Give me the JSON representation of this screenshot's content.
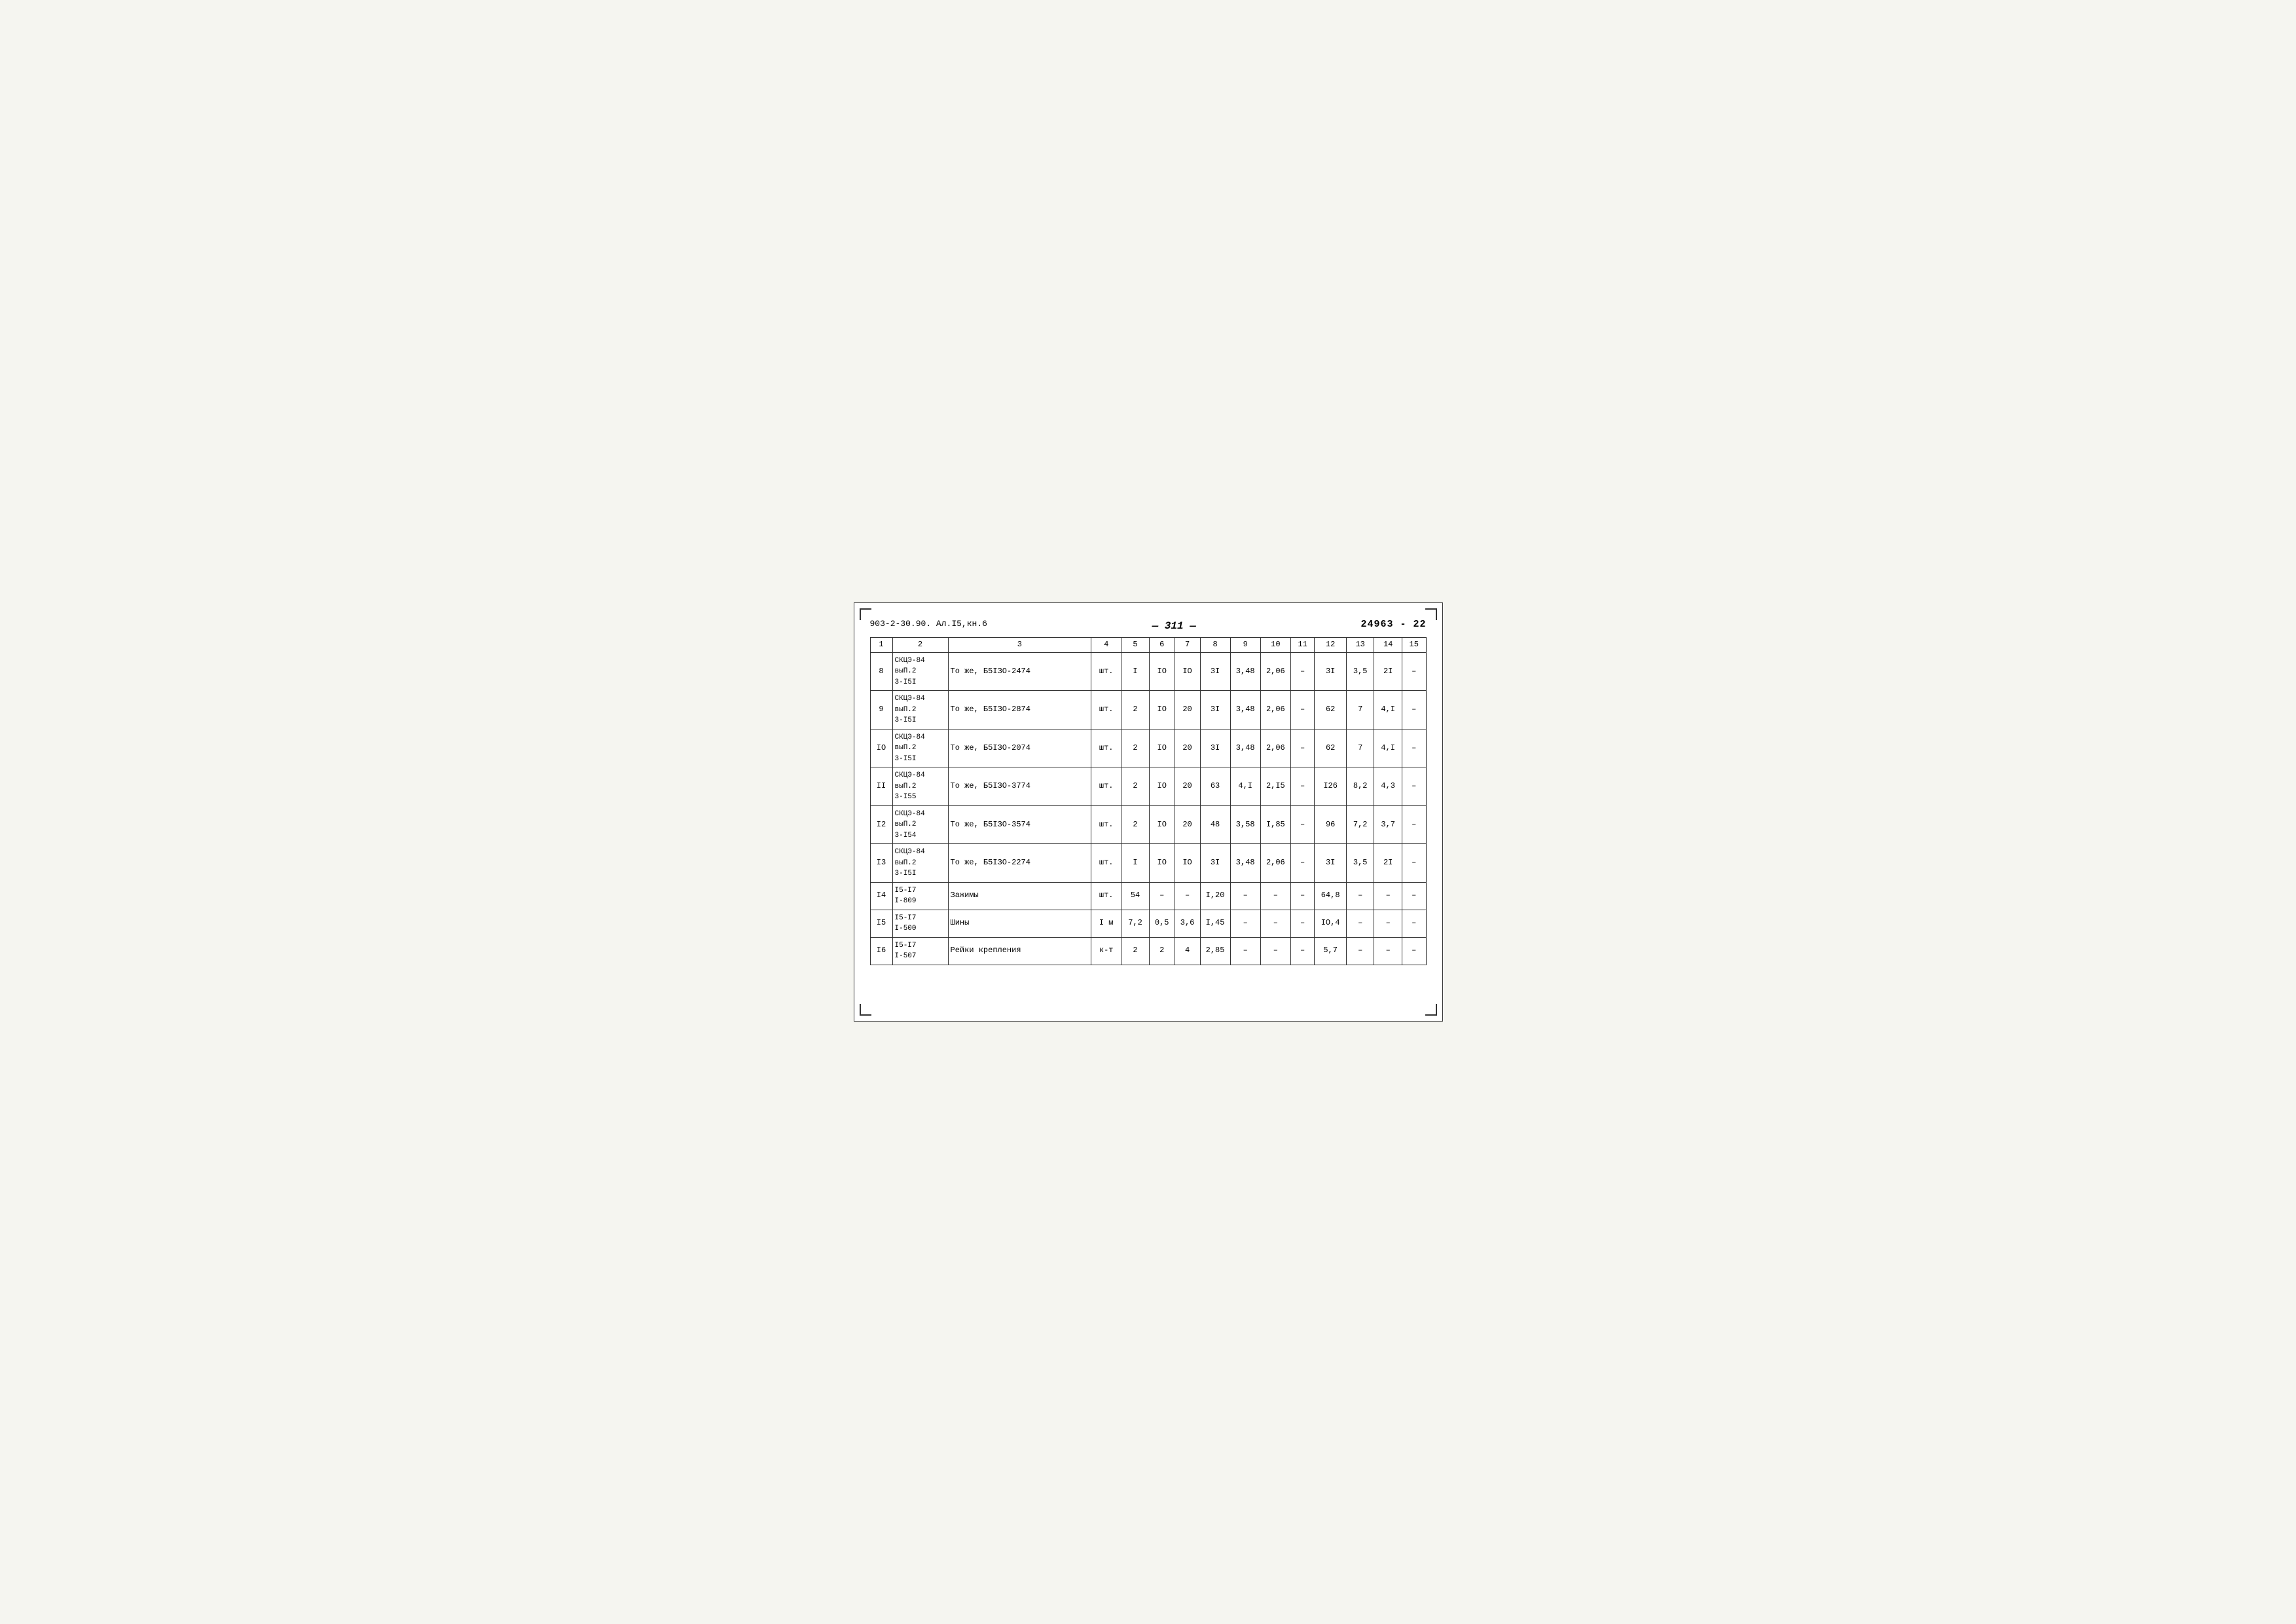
{
  "header": {
    "doc_ref": "903-2-30.90. Ал.I5,кн.6",
    "page_num": "— 311 —",
    "doc_num": "24963 - 22"
  },
  "table": {
    "columns": [
      {
        "id": "1",
        "label": "1"
      },
      {
        "id": "2",
        "label": "2"
      },
      {
        "id": "3",
        "label": "3"
      },
      {
        "id": "4",
        "label": "4"
      },
      {
        "id": "5",
        "label": "5"
      },
      {
        "id": "6",
        "label": "6"
      },
      {
        "id": "7",
        "label": "7"
      },
      {
        "id": "8",
        "label": "8"
      },
      {
        "id": "9",
        "label": "9"
      },
      {
        "id": "10",
        "label": "10"
      },
      {
        "id": "11",
        "label": "11"
      },
      {
        "id": "12",
        "label": "12"
      },
      {
        "id": "13",
        "label": "13"
      },
      {
        "id": "14",
        "label": "14"
      },
      {
        "id": "15",
        "label": "15"
      }
    ],
    "rows": [
      {
        "c1": "8",
        "c2_line1": "СКЦЭ-84",
        "c2_line2": "выП.2",
        "c2_line3": "3-I5I",
        "c3": "То же, Б5IЗО-2474",
        "c4": "шт.",
        "c5": "I",
        "c6": "IO",
        "c7": "IO",
        "c8": "3I",
        "c9": "3,48",
        "c10": "2,06",
        "c11": "–",
        "c12": "3I",
        "c13": "3,5",
        "c14": "2I",
        "c15": "–"
      },
      {
        "c1": "9",
        "c2_line1": "СКЦЭ-84",
        "c2_line2": "выП.2",
        "c2_line3": "3-I5I",
        "c3": "То же, Б5IЗО-2874",
        "c4": "шт.",
        "c5": "2",
        "c6": "IO",
        "c7": "20",
        "c8": "3I",
        "c9": "3,48",
        "c10": "2,06",
        "c11": "–",
        "c12": "62",
        "c13": "7",
        "c14": "4,I",
        "c15": "–"
      },
      {
        "c1": "IO",
        "c2_line1": "СКЦЭ-84",
        "c2_line2": "выП.2",
        "c2_line3": "3-I5I",
        "c3": "То же, Б5IЗО-2074",
        "c4": "шт.",
        "c5": "2",
        "c6": "IO",
        "c7": "20",
        "c8": "3I",
        "c9": "3,48",
        "c10": "2,06",
        "c11": "–",
        "c12": "62",
        "c13": "7",
        "c14": "4,I",
        "c15": "–"
      },
      {
        "c1": "II",
        "c2_line1": "СКЦЭ-84",
        "c2_line2": "выП.2",
        "c2_line3": "3-I55",
        "c3": "То же, Б5IЗО-3774",
        "c4": "шт.",
        "c5": "2",
        "c6": "IO",
        "c7": "20",
        "c8": "63",
        "c9": "4,I",
        "c10": "2,I5",
        "c11": "–",
        "c12": "I26",
        "c13": "8,2",
        "c14": "4,3",
        "c15": "–"
      },
      {
        "c1": "I2",
        "c2_line1": "СКЦЭ-84",
        "c2_line2": "выП.2",
        "c2_line3": "3-I54",
        "c3": "То же, Б5IЗО-3574",
        "c4": "шт.",
        "c5": "2",
        "c6": "IO",
        "c7": "20",
        "c8": "48",
        "c9": "3,58",
        "c10": "I,85",
        "c11": "–",
        "c12": "96",
        "c13": "7,2",
        "c14": "3,7",
        "c15": "–"
      },
      {
        "c1": "I3",
        "c2_line1": "СКЦЭ-84",
        "c2_line2": "выП.2",
        "c2_line3": "3-I5I",
        "c3": "То же, Б5IЗО-2274",
        "c4": "шт.",
        "c5": "I",
        "c6": "IO",
        "c7": "IO",
        "c8": "3I",
        "c9": "3,48",
        "c10": "2,06",
        "c11": "–",
        "c12": "3I",
        "c13": "3,5",
        "c14": "2I",
        "c15": "–"
      },
      {
        "c1": "I4",
        "c2_line1": "I5-I7",
        "c2_line2": "I-809",
        "c2_line3": "",
        "c3": "Зажимы",
        "c4": "шт.",
        "c5": "54",
        "c6": "–",
        "c7": "–",
        "c8": "I,20",
        "c9": "–",
        "c10": "–",
        "c11": "–",
        "c12": "64,8",
        "c13": "–",
        "c14": "–",
        "c15": "–"
      },
      {
        "c1": "I5",
        "c2_line1": "I5-I7",
        "c2_line2": "I-500",
        "c2_line3": "",
        "c3": "Шины",
        "c4": "I м",
        "c5": "7,2",
        "c6": "0,5",
        "c7": "3,6",
        "c8": "I,45",
        "c9": "–",
        "c10": "–",
        "c11": "–",
        "c12": "IO,4",
        "c13": "–",
        "c14": "–",
        "c15": "–"
      },
      {
        "c1": "I6",
        "c2_line1": "I5-I7",
        "c2_line2": "I-507",
        "c2_line3": "",
        "c3": "Рейки крепления",
        "c4": "к-т",
        "c5": "2",
        "c6": "2",
        "c7": "4",
        "c8": "2,85",
        "c9": "–",
        "c10": "–",
        "c11": "–",
        "c12": "5,7",
        "c13": "–",
        "c14": "–",
        "c15": "–"
      }
    ]
  }
}
